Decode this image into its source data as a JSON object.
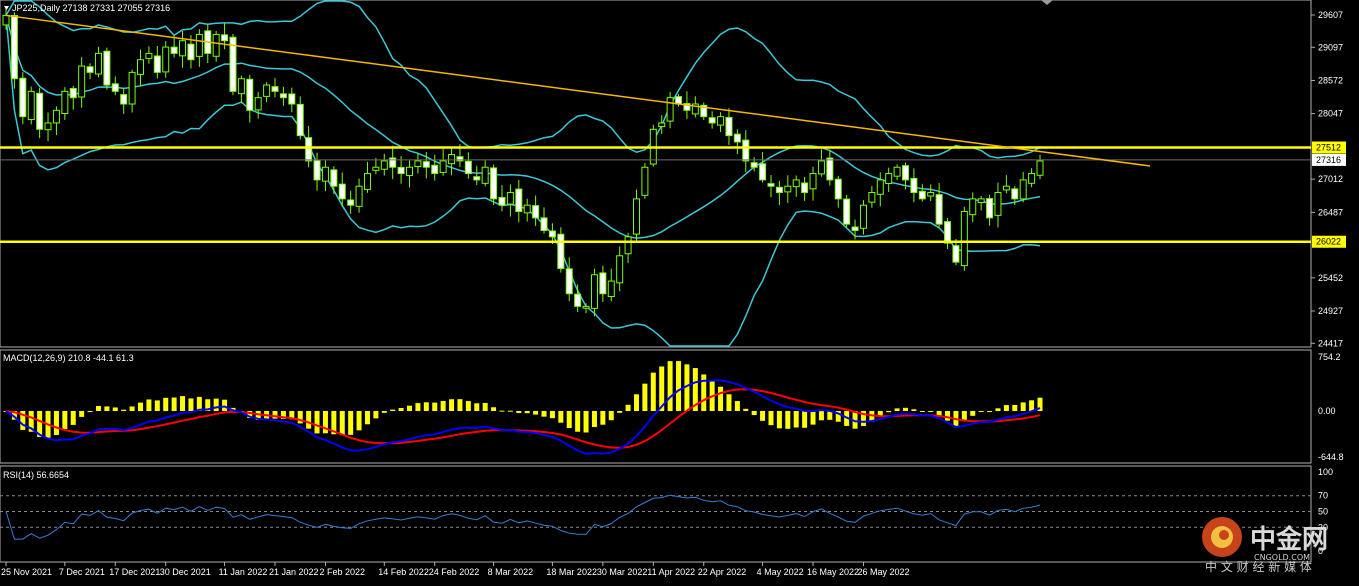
{
  "chart_data": {
    "type": "candlestick",
    "symbol_info": "JP225,Daily  27138 27331 27055 27316",
    "price_ticks": [
      "29607",
      "29097",
      "28572",
      "28047",
      "27512",
      "27316",
      "27012",
      "26487",
      "26022",
      "25452",
      "24927",
      "24417"
    ],
    "tag_resistance": "27512",
    "tag_current": "27316",
    "tag_support": "26022",
    "resistance": 27512,
    "support": 26022,
    "last_close": 27316,
    "price_range": [
      24417,
      29770
    ],
    "date_labels": [
      "25 Nov 2021",
      "7 Dec 2021",
      "17 Dec 2021",
      "30 Dec 2021",
      "11 Jan 2022",
      "21 Jan 2022",
      "2 Feb 2022",
      "14 Feb 2022",
      "24 Feb 2022",
      "8 Mar 2022",
      "18 Mar 2022",
      "30 Mar 2022",
      "11 Apr 2022",
      "22 Apr 2022",
      "4 May 2022",
      "16 May 2022",
      "26 May 2022"
    ],
    "closes": [
      29600,
      28600,
      28000,
      28400,
      27800,
      27900,
      28100,
      28400,
      28300,
      28800,
      28700,
      29000,
      28500,
      28400,
      28200,
      28700,
      28900,
      29000,
      28700,
      29100,
      29000,
      29200,
      28900,
      29300,
      29000,
      29300,
      29200,
      28400,
      28600,
      28100,
      28300,
      28500,
      28400,
      28300,
      28200,
      27700,
      27300,
      27000,
      27200,
      26900,
      26700,
      26600,
      26900,
      27100,
      27200,
      27300,
      27200,
      27100,
      27200,
      27300,
      27200,
      27100,
      27300,
      27400,
      27300,
      27100,
      27000,
      27200,
      26700,
      26600,
      26800,
      26500,
      26600,
      26400,
      26200,
      26100,
      25600,
      25200,
      25000,
      25000,
      25500,
      25200,
      25400,
      25800,
      26100,
      26700,
      27200,
      27800,
      27900,
      28300,
      28200,
      28100,
      28200,
      28000,
      27900,
      28000,
      27700,
      27600,
      27300,
      27200,
      27000,
      26900,
      26800,
      26900,
      27000,
      26800,
      27100,
      27300,
      27000,
      26700,
      26300,
      26200,
      26600,
      26800,
      27000,
      27100,
      27200,
      27000,
      26800,
      26700,
      26800,
      26300,
      26000,
      25700,
      26500,
      26700,
      26700,
      26400,
      26800,
      26900,
      26700,
      27000,
      27100,
      27300
    ]
  },
  "macd": {
    "label": "MACD(12,26,9) 210.8 -44.1 61.3",
    "ticks": [
      "754.2",
      "0.00",
      "-644.8"
    ],
    "range": [
      -644.8,
      754.2
    ]
  },
  "rsi": {
    "label": "RSI(14) 56.6654",
    "ticks": [
      "100",
      "70",
      "50",
      "30",
      "0"
    ],
    "last": 56.6654
  },
  "watermark": {
    "brand": "中金网",
    "site": "CNGOLD.COM",
    "tagline": "中 文 财 经 新 媒 体"
  }
}
